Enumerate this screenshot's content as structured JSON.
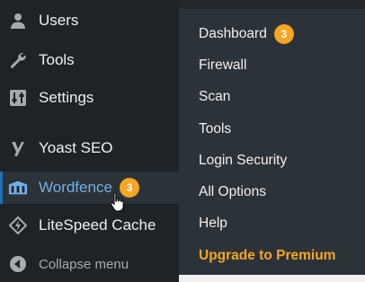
{
  "sidebar": {
    "items": [
      {
        "label": "Users",
        "icon": "users-icon"
      },
      {
        "label": "Tools",
        "icon": "wrench-icon"
      },
      {
        "label": "Settings",
        "icon": "sliders-icon"
      },
      {
        "label": "Yoast SEO",
        "icon": "yoast-icon"
      },
      {
        "label": "Wordfence",
        "icon": "wordfence-icon",
        "badge": "3"
      },
      {
        "label": "LiteSpeed Cache",
        "icon": "litespeed-icon"
      }
    ],
    "collapse_label": "Collapse menu"
  },
  "submenu": {
    "items": [
      {
        "label": "Dashboard",
        "badge": "3"
      },
      {
        "label": "Firewall"
      },
      {
        "label": "Scan"
      },
      {
        "label": "Tools"
      },
      {
        "label": "Login Security"
      },
      {
        "label": "All Options"
      },
      {
        "label": "Help"
      },
      {
        "label": "Upgrade to Premium"
      }
    ]
  },
  "colors": {
    "sidebar_bg": "#1d2327",
    "submenu_bg": "#2c3338",
    "active_text": "#72aee6",
    "badge_bg": "#f5a623",
    "premium_text": "#f5a623"
  }
}
